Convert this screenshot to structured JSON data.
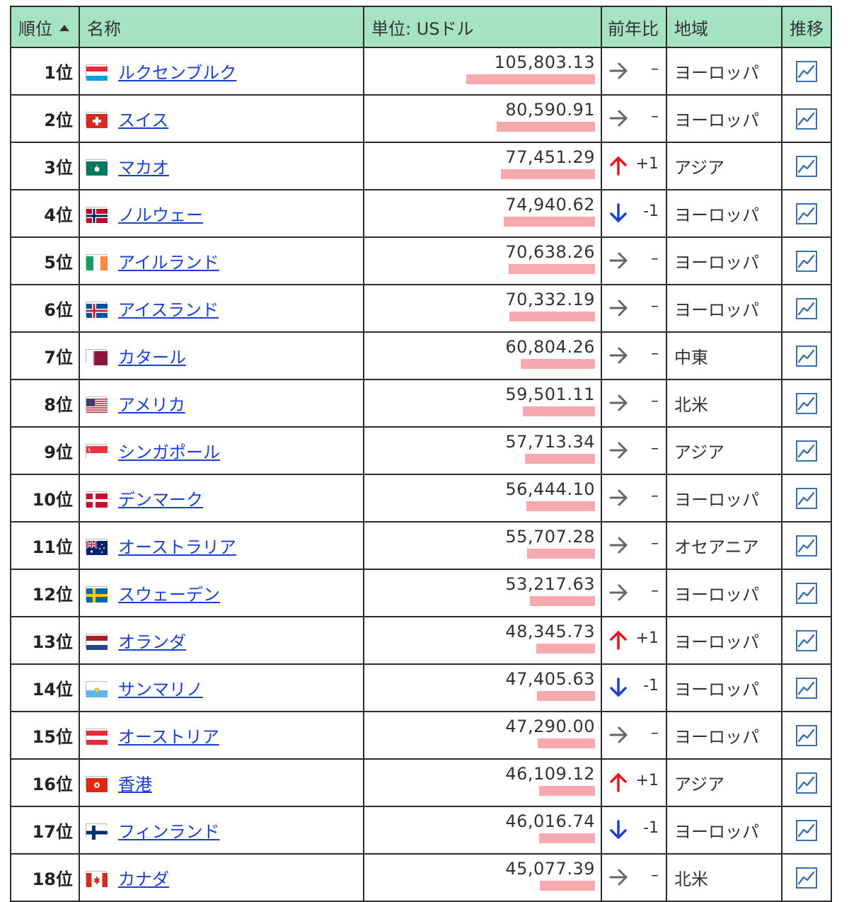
{
  "header": {
    "rank": "順位",
    "name": "名称",
    "value": "単位: USドル",
    "change": "前年比",
    "region": "地域",
    "trend": "推移"
  },
  "colors": {
    "header_bg": "#a6e2c4",
    "bar": "#f6aab0",
    "link": "#1a3fd6",
    "up": "#e8141e",
    "down": "#1a3fd6",
    "same": "#666666"
  },
  "rows": [
    {
      "rank": "1位",
      "name": "ルクセンブルク",
      "flag": "luxembourg",
      "value": "105,803.13",
      "num": 105803.13,
      "dir": "same",
      "change": "–",
      "region": "ヨーロッパ"
    },
    {
      "rank": "2位",
      "name": "スイス",
      "flag": "switzerland",
      "value": "80,590.91",
      "num": 80590.91,
      "dir": "same",
      "change": "–",
      "region": "ヨーロッパ"
    },
    {
      "rank": "3位",
      "name": "マカオ",
      "flag": "macao",
      "value": "77,451.29",
      "num": 77451.29,
      "dir": "up",
      "change": "+1",
      "region": "アジア"
    },
    {
      "rank": "4位",
      "name": "ノルウェー",
      "flag": "norway",
      "value": "74,940.62",
      "num": 74940.62,
      "dir": "down",
      "change": "-1",
      "region": "ヨーロッパ"
    },
    {
      "rank": "5位",
      "name": "アイルランド",
      "flag": "ireland",
      "value": "70,638.26",
      "num": 70638.26,
      "dir": "same",
      "change": "–",
      "region": "ヨーロッパ"
    },
    {
      "rank": "6位",
      "name": "アイスランド",
      "flag": "iceland",
      "value": "70,332.19",
      "num": 70332.19,
      "dir": "same",
      "change": "–",
      "region": "ヨーロッパ"
    },
    {
      "rank": "7位",
      "name": "カタール",
      "flag": "qatar",
      "value": "60,804.26",
      "num": 60804.26,
      "dir": "same",
      "change": "–",
      "region": "中東"
    },
    {
      "rank": "8位",
      "name": "アメリカ",
      "flag": "usa",
      "value": "59,501.11",
      "num": 59501.11,
      "dir": "same",
      "change": "–",
      "region": "北米"
    },
    {
      "rank": "9位",
      "name": "シンガポール",
      "flag": "singapore",
      "value": "57,713.34",
      "num": 57713.34,
      "dir": "same",
      "change": "–",
      "region": "アジア"
    },
    {
      "rank": "10位",
      "name": "デンマーク",
      "flag": "denmark",
      "value": "56,444.10",
      "num": 56444.1,
      "dir": "same",
      "change": "–",
      "region": "ヨーロッパ"
    },
    {
      "rank": "11位",
      "name": "オーストラリア",
      "flag": "australia",
      "value": "55,707.28",
      "num": 55707.28,
      "dir": "same",
      "change": "–",
      "region": "オセアニア"
    },
    {
      "rank": "12位",
      "name": "スウェーデン",
      "flag": "sweden",
      "value": "53,217.63",
      "num": 53217.63,
      "dir": "same",
      "change": "–",
      "region": "ヨーロッパ"
    },
    {
      "rank": "13位",
      "name": "オランダ",
      "flag": "netherlands",
      "value": "48,345.73",
      "num": 48345.73,
      "dir": "up",
      "change": "+1",
      "region": "ヨーロッパ"
    },
    {
      "rank": "14位",
      "name": "サンマリノ",
      "flag": "san-marino",
      "value": "47,405.63",
      "num": 47405.63,
      "dir": "down",
      "change": "-1",
      "region": "ヨーロッパ"
    },
    {
      "rank": "15位",
      "name": "オーストリア",
      "flag": "austria",
      "value": "47,290.00",
      "num": 47290.0,
      "dir": "same",
      "change": "–",
      "region": "ヨーロッパ"
    },
    {
      "rank": "16位",
      "name": "香港",
      "flag": "hong-kong",
      "value": "46,109.12",
      "num": 46109.12,
      "dir": "up",
      "change": "+1",
      "region": "アジア"
    },
    {
      "rank": "17位",
      "name": "フィンランド",
      "flag": "finland",
      "value": "46,016.74",
      "num": 46016.74,
      "dir": "down",
      "change": "-1",
      "region": "ヨーロッパ"
    },
    {
      "rank": "18位",
      "name": "カナダ",
      "flag": "canada",
      "value": "45,077.39",
      "num": 45077.39,
      "dir": "same",
      "change": "–",
      "region": "北米"
    }
  ]
}
